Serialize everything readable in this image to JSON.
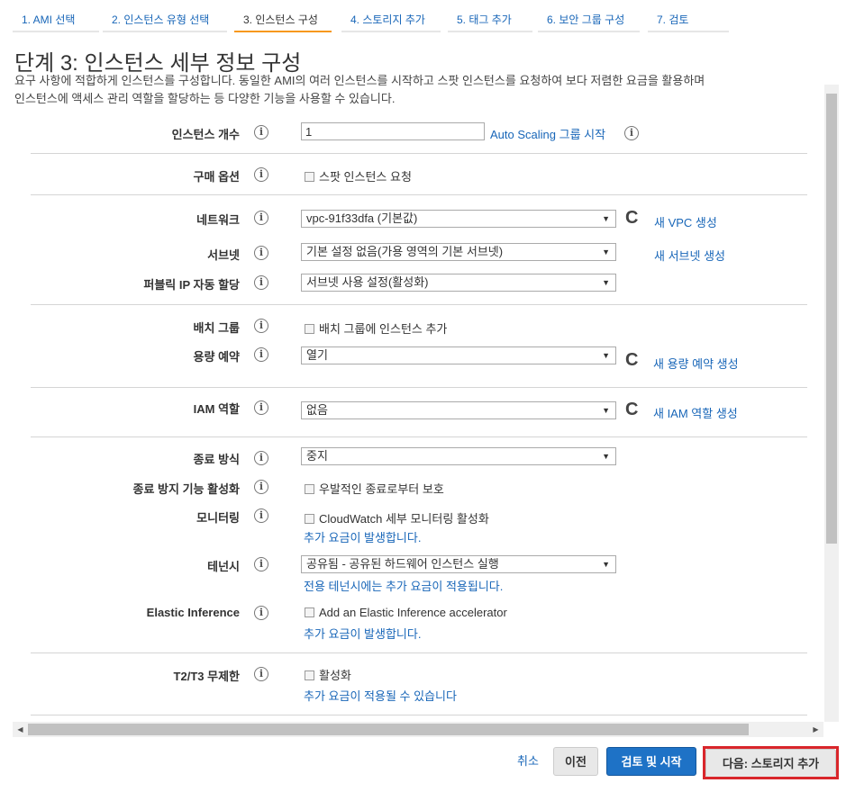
{
  "tabs": [
    {
      "label": "1. AMI 선택"
    },
    {
      "label": "2. 인스턴스 유형 선택"
    },
    {
      "label": "3. 인스턴스 구성"
    },
    {
      "label": "4. 스토리지 추가"
    },
    {
      "label": "5. 태그 추가"
    },
    {
      "label": "6. 보안 그룹 구성"
    },
    {
      "label": "7. 검토"
    }
  ],
  "page": {
    "title": "단계 3: 인스턴스 세부 정보 구성",
    "intro_line1": "요구 사항에 적합하게 인스턴스를 구성합니다. 동일한 AMI의 여러 인스턴스를 시작하고 스팟 인스턴스를 요청하여 보다 저렴한 요금을 활용하며",
    "intro_line2": "인스턴스에 액세스 관리 역할을 할당하는 등 다양한 기능을 사용할 수 있습니다."
  },
  "info_glyph": "i",
  "refresh_glyph": "C",
  "select_arrow": "▼",
  "form": {
    "instance_count": {
      "label": "인스턴스 개수",
      "value": "1",
      "link": "Auto Scaling 그룹 시작"
    },
    "purchase": {
      "label": "구매 옵션",
      "checkbox": "스팟 인스턴스 요청"
    },
    "network": {
      "label": "네트워크",
      "value": "vpc-91f33dfa (기본값)",
      "link": "새 VPC 생성"
    },
    "subnet": {
      "label": "서브넷",
      "value": "기본 설정 없음(가용 영역의 기본 서브넷)",
      "link": "새 서브넷 생성"
    },
    "public_ip": {
      "label": "퍼블릭 IP 자동 할당",
      "value": "서브넷 사용 설정(활성화)"
    },
    "placement": {
      "label": "배치 그룹",
      "checkbox": "배치 그룹에 인스턴스 추가"
    },
    "capacity": {
      "label": "용량 예약",
      "value": "열기",
      "link": "새 용량 예약 생성"
    },
    "iam": {
      "label": "IAM 역할",
      "value": "없음",
      "link": "새 IAM 역할 생성"
    },
    "shutdown": {
      "label": "종료 방식",
      "value": "중지"
    },
    "termination": {
      "label": "종료 방지 기능 활성화",
      "checkbox": "우발적인 종료로부터 보호"
    },
    "monitoring": {
      "label": "모니터링",
      "checkbox": "CloudWatch 세부 모니터링 활성화",
      "note": "추가 요금이 발생합니다."
    },
    "tenancy": {
      "label": "테넌시",
      "value": "공유됨 - 공유된 하드웨어 인스턴스 실행",
      "note": "전용 테넌시에는 추가 요금이 적용됩니다."
    },
    "elastic": {
      "label": "Elastic Inference",
      "checkbox": "Add an Elastic Inference accelerator",
      "note": "추가 요금이 발생합니다."
    },
    "t2t3": {
      "label": "T2/T3 무제한",
      "checkbox": "활성화",
      "note": "추가 요금이 적용될 수 있습니다"
    }
  },
  "scroll": {
    "left_arrow": "◀",
    "right_arrow": "▶"
  },
  "footer": {
    "cancel": "취소",
    "previous": "이전",
    "review_launch": "검토 및 시작",
    "next": "다음: 스토리지 추가"
  }
}
